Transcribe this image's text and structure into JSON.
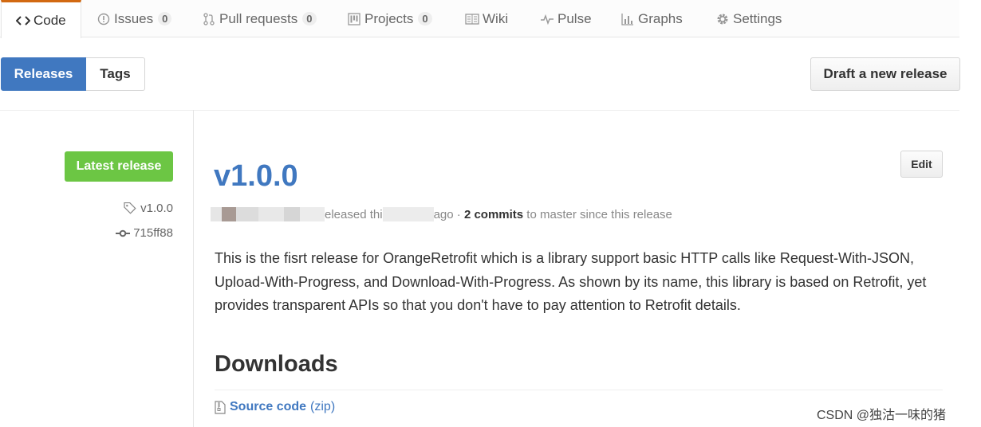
{
  "nav": {
    "tabs": [
      {
        "label": "Code",
        "icon": "code-icon",
        "selected": true
      },
      {
        "label": "Issues",
        "count": "0",
        "icon": "issue-icon"
      },
      {
        "label": "Pull requests",
        "count": "0",
        "icon": "pull-request-icon"
      },
      {
        "label": "Projects",
        "count": "0",
        "icon": "project-icon"
      },
      {
        "label": "Wiki",
        "icon": "book-icon"
      },
      {
        "label": "Pulse",
        "icon": "pulse-icon"
      },
      {
        "label": "Graphs",
        "icon": "graph-icon"
      },
      {
        "label": "Settings",
        "icon": "gear-icon"
      }
    ]
  },
  "subnav": {
    "releases_label": "Releases",
    "tags_label": "Tags",
    "draft_label": "Draft a new release"
  },
  "release": {
    "badge": "Latest release",
    "tag": "v1.0.0",
    "commit": "715ff88",
    "title": "v1.0.0",
    "edit_label": "Edit",
    "meta_released": "eleased thi",
    "meta_ago": "ago",
    "meta_sep": " · ",
    "meta_commits": "2 commits",
    "meta_tail": " to master since this release",
    "description": "This is the fisrt release for OrangeRetrofit which is a library support basic HTTP calls like Request-With-JSON, Upload-With-Progress, and Download-With-Progress. As shown by its name, this library is based on Retrofit, yet provides transparent APIs so that you don't have to pay attention to Retrofit details."
  },
  "downloads": {
    "title": "Downloads",
    "source_label": "Source code",
    "zip_label": "(zip)"
  },
  "watermark": "CSDN @独沽一味的猪",
  "colors": {
    "accent": "#4078c0",
    "latest_badge": "#6cc644",
    "selected_tab_border": "#d26911"
  }
}
